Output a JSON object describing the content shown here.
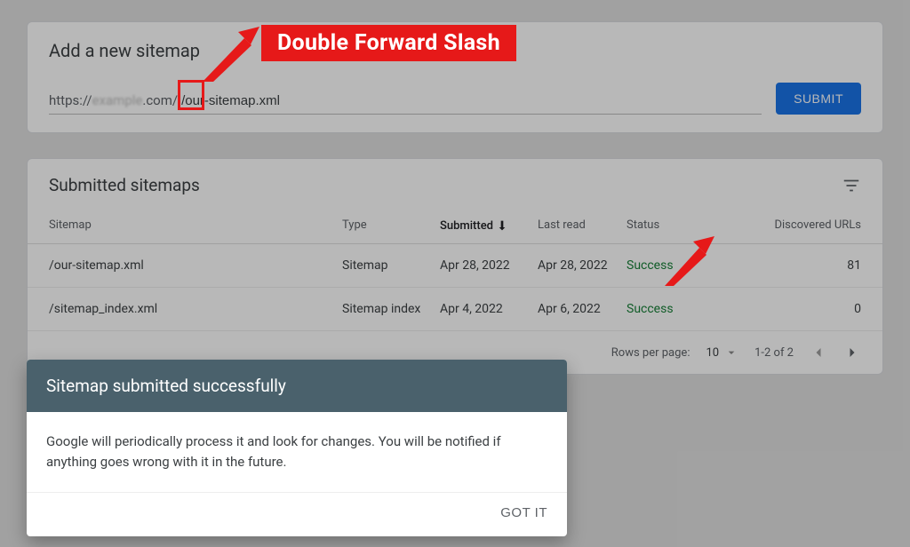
{
  "add": {
    "title": "Add a new sitemap",
    "prefix": "https://",
    "blurred": "example",
    "domain_suffix": ".com/",
    "value": "/our-sitemap.xml",
    "submit": "SUBMIT"
  },
  "table": {
    "title": "Submitted sitemaps",
    "cols": {
      "sitemap": "Sitemap",
      "type": "Type",
      "submitted": "Submitted",
      "lastread": "Last read",
      "status": "Status",
      "urls": "Discovered URLs"
    },
    "rows": [
      {
        "sitemap": "/our-sitemap.xml",
        "type": "Sitemap",
        "submitted": "Apr 28, 2022",
        "lastread": "Apr 28, 2022",
        "status": "Success",
        "urls": "81"
      },
      {
        "sitemap": "/sitemap_index.xml",
        "type": "Sitemap index",
        "submitted": "Apr 4, 2022",
        "lastread": "Apr 6, 2022",
        "status": "Success",
        "urls": "0"
      }
    ]
  },
  "pagination": {
    "rows_label": "Rows per page:",
    "rows_value": "10",
    "range": "1-2 of 2"
  },
  "dialog": {
    "title": "Sitemap submitted successfully",
    "body": "Google will periodically process it and look for changes. You will be notified if anything goes wrong with it in the future.",
    "ok": "GOT IT"
  },
  "annotations": {
    "slash_label": "Double Forward Slash"
  }
}
